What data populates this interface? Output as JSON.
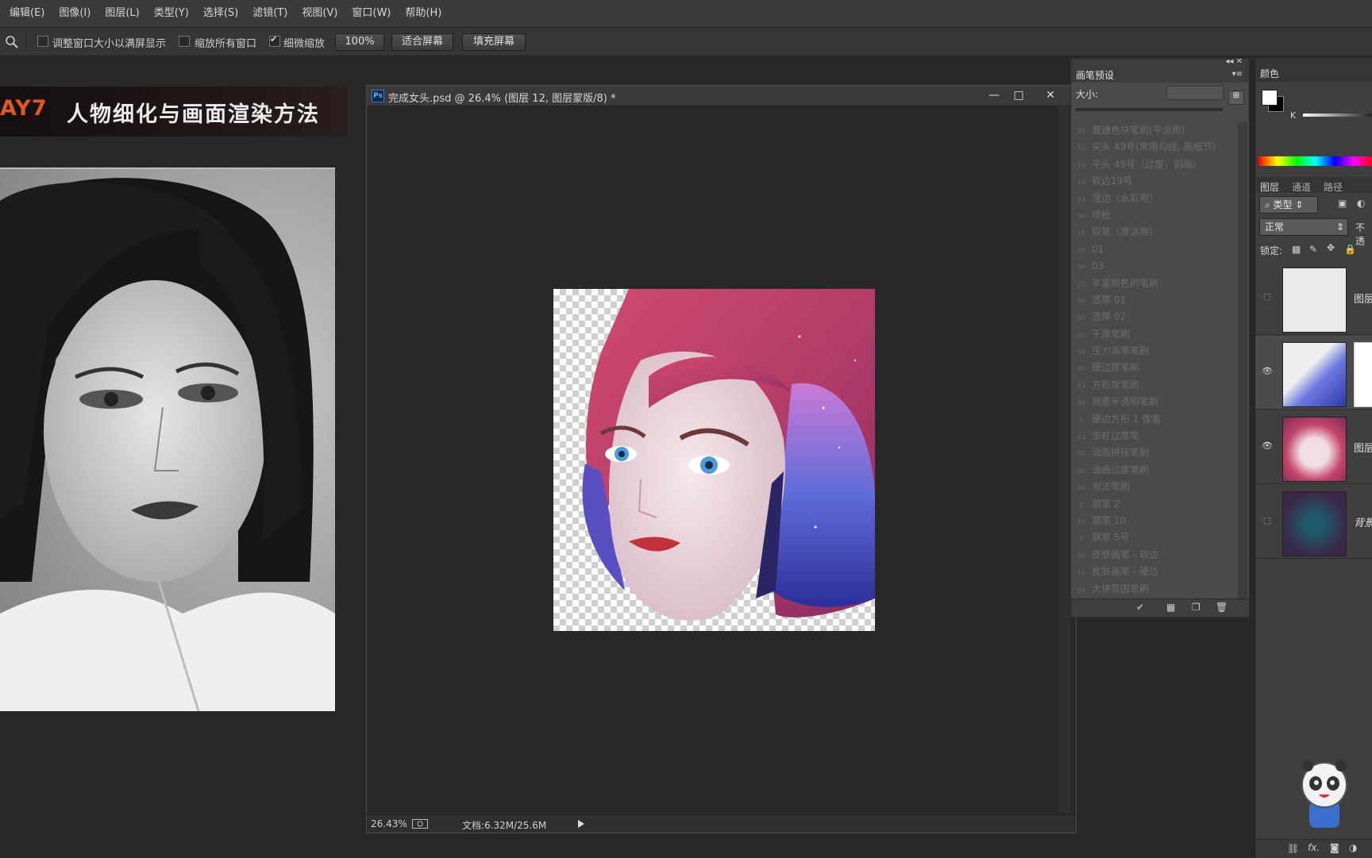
{
  "menu": [
    "编辑(E)",
    "图像(I)",
    "图层(L)",
    "类型(Y)",
    "选择(S)",
    "滤镜(T)",
    "视图(V)",
    "窗口(W)",
    "帮助(H)"
  ],
  "options": {
    "zoom_icon": "zoom-icon",
    "resize_windows": "调整窗口大小以满屏显示",
    "zoom_all": "缩放所有窗口",
    "scrubby_zoom": "细微缩放",
    "zoom_100": "100%",
    "fit_screen": "适合屏幕",
    "fill_screen": "填充屏幕",
    "resize_checked": false,
    "zoom_all_checked": false,
    "scrubby_checked": true
  },
  "banner": {
    "day": "AY7",
    "title": "人物细化与画面渲染方法"
  },
  "document": {
    "title": "完成女头.psd @ 26.4% (图层 12, 图层蒙版/8) *",
    "ps_badge": "Ps",
    "zoom": "26.43%",
    "doc_size": "文档:6.32M/25.6M",
    "minimize": "—",
    "maximize": "□",
    "close": "✕"
  },
  "brush_panel": {
    "tab": "画笔预设",
    "size_label": "大小:",
    "items": [
      {
        "size": "35",
        "name": "普通色块笔刷(平涂用)"
      },
      {
        "size": "10",
        "name": "尖头 49号(常用勾线, 画细节)"
      },
      {
        "size": "19",
        "name": "平头 49号（过度，刻画）"
      },
      {
        "size": "13",
        "name": "软边19号"
      },
      {
        "size": "64",
        "name": "湿边（水彩用）"
      },
      {
        "size": "30",
        "name": "喷枪"
      },
      {
        "size": "16",
        "name": "铅笔（厚涂用）"
      },
      {
        "size": "30",
        "name": "01"
      },
      {
        "size": "30",
        "name": "03"
      },
      {
        "size": "25",
        "name": "丰富颜色的笔刷"
      },
      {
        "size": "50",
        "name": "渲厚 01"
      },
      {
        "size": "60",
        "name": "渲厚 02"
      },
      {
        "size": "45",
        "name": "干厚笔刷"
      },
      {
        "size": "50",
        "name": "压力渐厚笔刷"
      },
      {
        "size": "40",
        "name": "硬边厚笔刷"
      },
      {
        "size": "63",
        "name": "方形厚笔刷"
      },
      {
        "size": "30",
        "name": "侧墨半透明笔刷"
      },
      {
        "size": "1",
        "name": "硬边方形 1 像素"
      },
      {
        "size": "63",
        "name": "虫蛀过度笔"
      },
      {
        "size": "40",
        "name": "油画拼接笔刷"
      },
      {
        "size": "40",
        "name": "油画过度笔刷"
      },
      {
        "size": "60",
        "name": "书法笔刷"
      },
      {
        "size": "5",
        "name": "钢笔 2"
      },
      {
        "size": "10",
        "name": "钢笔 10"
      },
      {
        "size": "5",
        "name": "钢笔 5号"
      },
      {
        "size": "30",
        "name": "皮肤画笔 - 软边"
      },
      {
        "size": "11",
        "name": "皮肤画笔 - 硬边"
      },
      {
        "size": "48",
        "name": "大块景国笔刷"
      }
    ]
  },
  "right_panel": {
    "color_tab": "颜色",
    "k_label": "K",
    "layer_tabs": [
      "图层",
      "通道",
      "路径"
    ],
    "filter_kind": "类型",
    "blend_mode": "正常",
    "opacity_label": "不透",
    "lock_label": "锁定:",
    "layers": [
      {
        "name": "图层",
        "visible": false
      },
      {
        "name": "",
        "visible": true
      },
      {
        "name": "图层",
        "visible": true
      },
      {
        "name": "背景",
        "visible": false
      }
    ],
    "footer_icons": [
      "link-icon",
      "fx-icon",
      "mask-icon",
      "adjustment-icon"
    ]
  }
}
